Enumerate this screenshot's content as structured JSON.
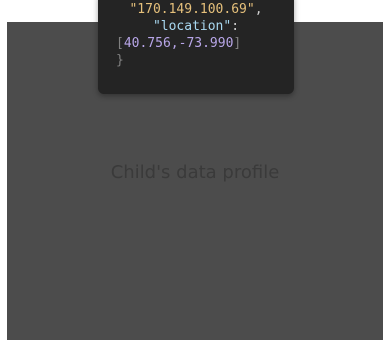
{
  "panel": {
    "caption": "Child's data profile"
  },
  "code": {
    "ip_string": "\"170.149.100.69\"",
    "ip_comma": ",",
    "location_key": "\"location\"",
    "location_colon": ":",
    "open_bracket": "[",
    "lat": "40.756",
    "sep": ",",
    "lon": "-73.990",
    "close_bracket": "]",
    "close_brace": "}"
  },
  "colors": {
    "panel_bg": "#4c4c4c",
    "card_bg": "#242424",
    "string": "#e5c07b",
    "key": "#a8d8f0",
    "number": "#b8a6e8"
  }
}
